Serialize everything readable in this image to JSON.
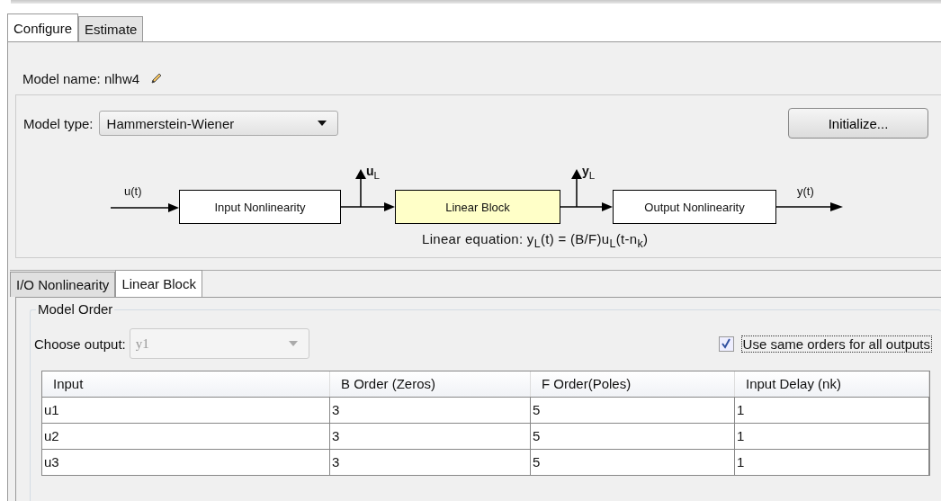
{
  "tabs": [
    {
      "label": "Configure",
      "selected": true
    },
    {
      "label": "Estimate",
      "selected": false
    }
  ],
  "model_name": "Model name: nlhw4",
  "model_type": {
    "label": "Model type:",
    "value": "Hammerstein-Wiener"
  },
  "initialize_button": "Initialize...",
  "diagram": {
    "input_label": "u(t)",
    "output_label": "y(t)",
    "blocks": [
      {
        "label": "Input Nonlinearity",
        "kind": "plain"
      },
      {
        "label": "Linear Block",
        "kind": "highlighted"
      },
      {
        "label": "Output Nonlinearity",
        "kind": "plain"
      }
    ],
    "taps": [
      "**u**$_{L}$",
      "**y**$_{L}$"
    ],
    "equation": "Linear equation:  y$_{L}$(t) = (B/F)u$_{L}$(t-n$_{k}$)"
  },
  "sub_tabs": [
    {
      "label": "I/O Nonlinearity",
      "selected": false
    },
    {
      "label": "Linear Block",
      "selected": true
    }
  ],
  "group_title": "Model Order",
  "choose_output": {
    "label": "Choose output:",
    "value": "y1",
    "disabled": true
  },
  "same_orders": {
    "label": "Use same orders for all outputs",
    "checked": true
  },
  "table": {
    "columns": [
      "Input",
      "B Order (Zeros)",
      "F Order(Poles)",
      "Input Delay (nk)"
    ],
    "rows": [
      [
        "u1",
        "3",
        "5",
        "1"
      ],
      [
        "u2",
        "3",
        "5",
        "1"
      ],
      [
        "u3",
        "3",
        "5",
        "1"
      ]
    ]
  }
}
